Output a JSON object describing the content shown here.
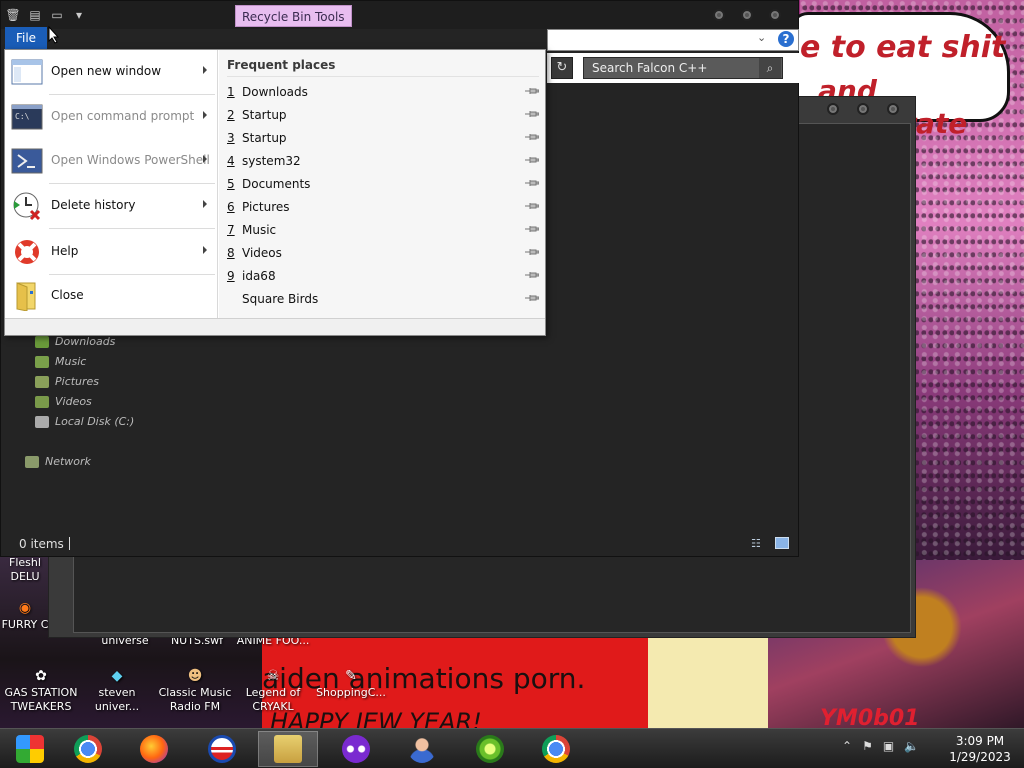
{
  "window": {
    "contextual_tab": "Recycle Bin Tools",
    "file_tab": "File",
    "search_placeholder": "Search Falcon C++",
    "help": "?"
  },
  "file_menu": {
    "commands": [
      {
        "label": "Open new window",
        "icon": "new-window-icon",
        "has_arrow": true,
        "disabled": false
      },
      {
        "label": "Open command prompt",
        "icon": "command-prompt-icon",
        "has_arrow": true,
        "disabled": true
      },
      {
        "label": "Open Windows PowerShell",
        "icon": "powershell-icon",
        "has_arrow": true,
        "disabled": true
      },
      {
        "label": "Delete history",
        "icon": "delete-history-icon",
        "has_arrow": true,
        "disabled": false
      },
      {
        "label": "Help",
        "icon": "help-lifebuoy-icon",
        "has_arrow": true,
        "disabled": false
      },
      {
        "label": "Close",
        "icon": "close-folder-icon",
        "has_arrow": false,
        "disabled": false
      }
    ],
    "frequent_header": "Frequent places",
    "frequent_places": [
      {
        "num": "1",
        "name": "Downloads"
      },
      {
        "num": "2",
        "name": "Startup"
      },
      {
        "num": "3",
        "name": "Startup"
      },
      {
        "num": "4",
        "name": "system32"
      },
      {
        "num": "5",
        "name": "Documents"
      },
      {
        "num": "6",
        "name": "Pictures"
      },
      {
        "num": "7",
        "name": "Music"
      },
      {
        "num": "8",
        "name": "Videos"
      },
      {
        "num": "9",
        "name": "ida68"
      },
      {
        "num": "",
        "name": "Square Birds"
      }
    ]
  },
  "nav_pane": {
    "items": [
      "Downloads",
      "Music",
      "Pictures",
      "Videos",
      "Local Disk (C:)"
    ],
    "network": "Network"
  },
  "status": {
    "items_count": "0 items"
  },
  "desktop": {
    "wallpaper_text1": "e to eat shit",
    "wallpaper_text2": "and celebrate",
    "wallpaper_bottom1": "aiden animations porn.",
    "wallpaper_bottom2": "HAPPY JEW YEAR!",
    "wallpaper_sig": "YM0b01",
    "icons": [
      {
        "label": "Fleshl DELU",
        "glyph": "▣"
      },
      {
        "label": "FURRY C",
        "glyph": "◉"
      },
      {
        "label": "GAS STATION TWEAKERS",
        "glyph": "✿"
      },
      {
        "label": "steven univer...",
        "glyph": "◆"
      },
      {
        "label": "Classic Music Radio FM",
        "glyph": "☻"
      },
      {
        "label": "Legend of CRYAKL",
        "glyph": "☠"
      },
      {
        "label": "ShoppingC...",
        "glyph": "✎"
      },
      {
        "label": "universe",
        "glyph": ""
      },
      {
        "label": "NUTS.swf",
        "glyph": ""
      },
      {
        "label": "ANIME FOO...",
        "glyph": ""
      }
    ]
  },
  "taskbar": {
    "time": "3:09 PM",
    "date": "1/29/2023",
    "apps": [
      "chrome-colorful",
      "chrome",
      "firefox",
      "obama-logo",
      "file-explorer",
      "mask-app",
      "person-app",
      "lime-app",
      "chrome"
    ]
  }
}
